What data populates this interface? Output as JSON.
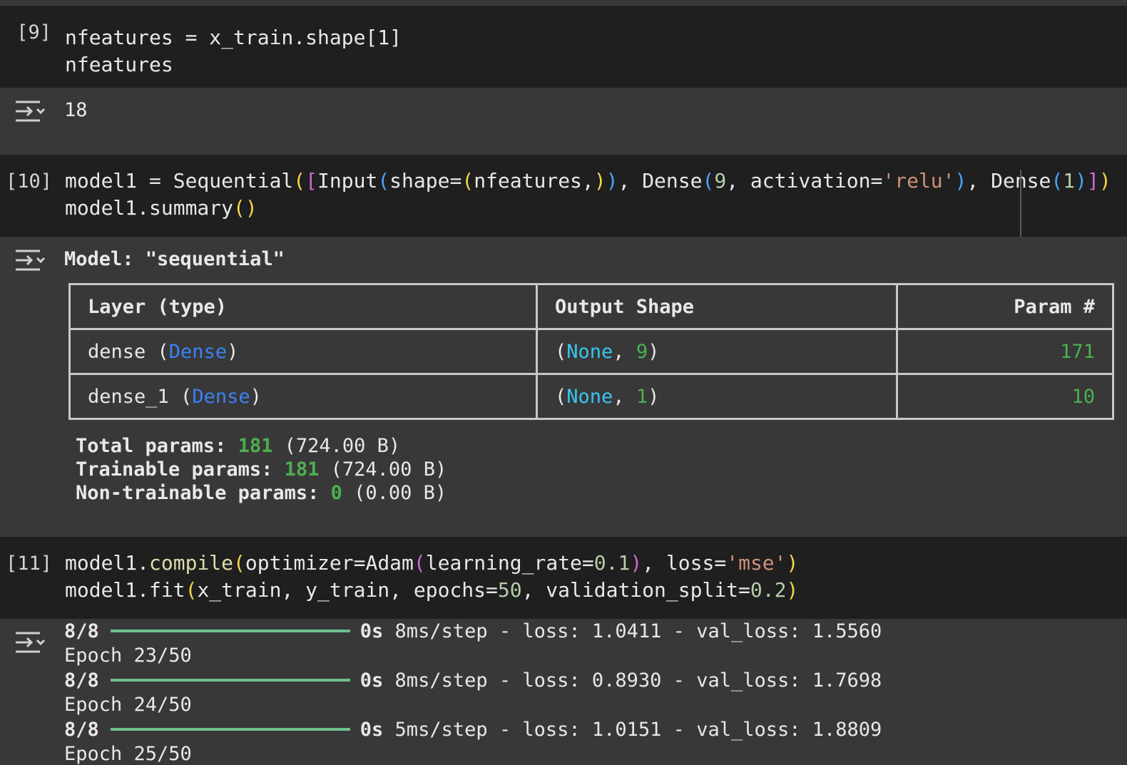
{
  "cells": [
    {
      "exec": "[9]",
      "code": [
        "nfeatures = x_train.shape[1]",
        "nfeatures"
      ],
      "output": "18"
    },
    {
      "exec": "[10]",
      "code_parts": {
        "l1": [
          "model1 = Sequential",
          "(",
          "[",
          "Input",
          "(",
          "shape=",
          "(",
          "nfeatures,",
          ")",
          ")",
          ", Dense",
          "(",
          "9",
          ", activation=",
          "'relu'",
          ")",
          ", Dense",
          "(",
          "1",
          ")",
          "]",
          ")"
        ],
        "l2": [
          "model1.summary",
          "()"
        ]
      },
      "summary": {
        "title": "Model: \"sequential\"",
        "headers": [
          "Layer (type)",
          "Output Shape",
          "Param #"
        ],
        "rows": [
          {
            "name": "dense (",
            "type": "Dense",
            "close": ")",
            "none": "None",
            "sep": ", ",
            "dim": "9",
            "params": "171"
          },
          {
            "name": "dense_1 (",
            "type": "Dense",
            "close": ")",
            "none": "None",
            "sep": ", ",
            "dim": "1",
            "params": "10"
          }
        ],
        "totals": [
          {
            "label": "Total params: ",
            "value": "181",
            "size": " (724.00 B)"
          },
          {
            "label": "Trainable params: ",
            "value": "181",
            "size": " (724.00 B)"
          },
          {
            "label": "Non-trainable params: ",
            "value": "0",
            "size": " (0.00 B)"
          }
        ]
      }
    },
    {
      "exec": "[11]",
      "code_parts": {
        "l1": [
          "model1.",
          "compile",
          "(",
          "optimizer=Adam",
          "(",
          "learning_rate=",
          "0.1",
          ")",
          ", loss=",
          "'mse'",
          ")"
        ],
        "l2": [
          "model1.fit",
          "(",
          "x_train, y_train, epochs=",
          "50",
          ", validation_split=",
          "0.2",
          ")"
        ]
      },
      "log": [
        {
          "type": "step",
          "steps": "8/8",
          "time": "0s",
          "rest": " 8ms/step - loss: 1.0411 - val_loss: 1.5560"
        },
        {
          "type": "epoch",
          "text": "Epoch 23/50"
        },
        {
          "type": "step",
          "steps": "8/8",
          "time": "0s",
          "rest": " 8ms/step - loss: 0.8930 - val_loss: 1.7698"
        },
        {
          "type": "epoch",
          "text": "Epoch 24/50"
        },
        {
          "type": "step",
          "steps": "8/8",
          "time": "0s",
          "rest": " 5ms/step - loss: 1.0151 - val_loss: 1.8809"
        },
        {
          "type": "epoch",
          "text": "Epoch 25/50"
        }
      ]
    }
  ],
  "icons": {
    "output_toggle": "output-collapse-icon"
  }
}
